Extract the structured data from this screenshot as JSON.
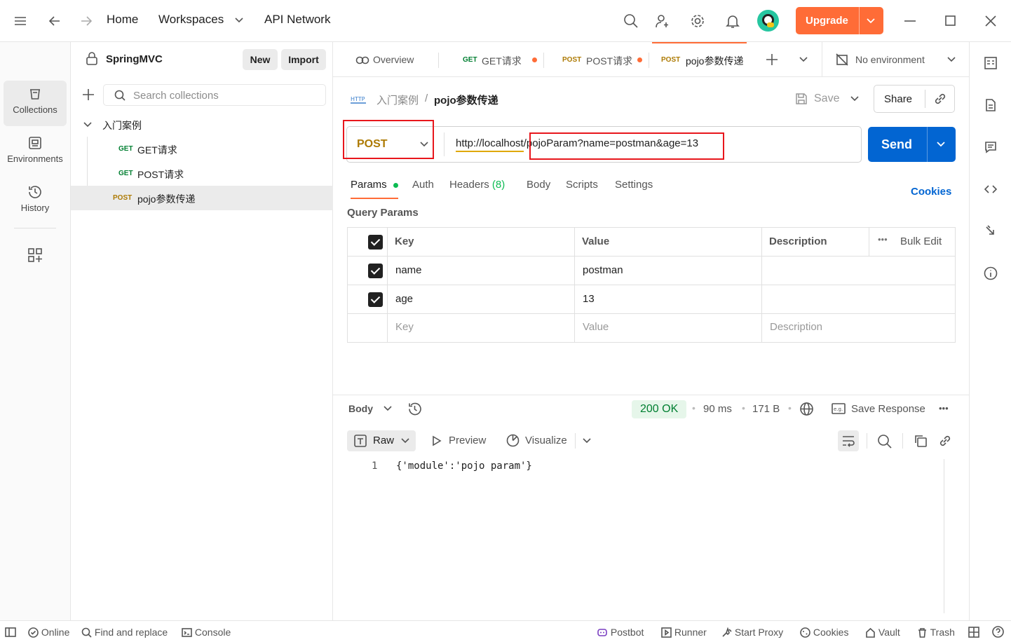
{
  "header": {
    "nav_home": "Home",
    "nav_workspaces": "Workspaces",
    "nav_api_network": "API Network",
    "upgrade_label": "Upgrade",
    "colors": {
      "upgrade": "#ff6c37",
      "send": "#0265d2"
    }
  },
  "rail": {
    "items": [
      {
        "label": "Collections",
        "icon": "collections-icon"
      },
      {
        "label": "Environments",
        "icon": "environments-icon"
      },
      {
        "label": "History",
        "icon": "history-icon"
      },
      {
        "label": "",
        "icon": "add-apps-icon"
      }
    ]
  },
  "sidebar": {
    "workspace_name": "SpringMVC",
    "new_label": "New",
    "import_label": "Import",
    "search_placeholder": "Search collections",
    "tree": [
      {
        "type": "folder",
        "label": "入门案例"
      },
      {
        "method": "GET",
        "label": "GET请求"
      },
      {
        "method": "GET",
        "label": "POST请求"
      },
      {
        "method": "POST",
        "label": "pojo参数传递",
        "selected": true
      }
    ]
  },
  "tabs": {
    "overview": "Overview",
    "open": [
      {
        "method": "GET",
        "label": "GET请求",
        "unsaved": true
      },
      {
        "method": "POST",
        "label": "POST请求",
        "unsaved": true
      },
      {
        "method": "POST",
        "label": "pojo参数传递",
        "active": true
      }
    ],
    "environment": "No environment"
  },
  "request": {
    "breadcrumb_parent": "入门案例",
    "breadcrumb_sep": "/",
    "breadcrumb_current": "pojo参数传递",
    "save_label": "Save",
    "share_label": "Share",
    "method": "POST",
    "url_base": "http://localhost",
    "url_rest": "/pojoParam?name=postman&age=13",
    "send_label": "Send",
    "subtabs": {
      "params": "Params",
      "auth": "Auth",
      "headers": "Headers",
      "headers_count": "(8)",
      "body": "Body",
      "scripts": "Scripts",
      "settings": "Settings",
      "cookies": "Cookies"
    },
    "query_params_title": "Query Params",
    "table": {
      "headers": {
        "key": "Key",
        "value": "Value",
        "description": "Description",
        "bulk_edit": "Bulk Edit"
      },
      "rows": [
        {
          "checked": true,
          "key": "name",
          "value": "postman",
          "description": ""
        },
        {
          "checked": true,
          "key": "age",
          "value": "13",
          "description": ""
        }
      ],
      "placeholder": {
        "key": "Key",
        "value": "Value",
        "description": "Description"
      }
    }
  },
  "response": {
    "body_label": "Body",
    "status": "200 OK",
    "time": "90 ms",
    "size": "171 B",
    "save_response": "Save Response",
    "view_raw": "Raw",
    "view_preview": "Preview",
    "view_visualize": "Visualize",
    "line_number": "1",
    "content": "{'module':'pojo param'}"
  },
  "statusbar": {
    "online": "Online",
    "find_replace": "Find and replace",
    "console": "Console",
    "postbot": "Postbot",
    "runner": "Runner",
    "start_proxy": "Start Proxy",
    "cookies": "Cookies",
    "vault": "Vault",
    "trash": "Trash"
  }
}
